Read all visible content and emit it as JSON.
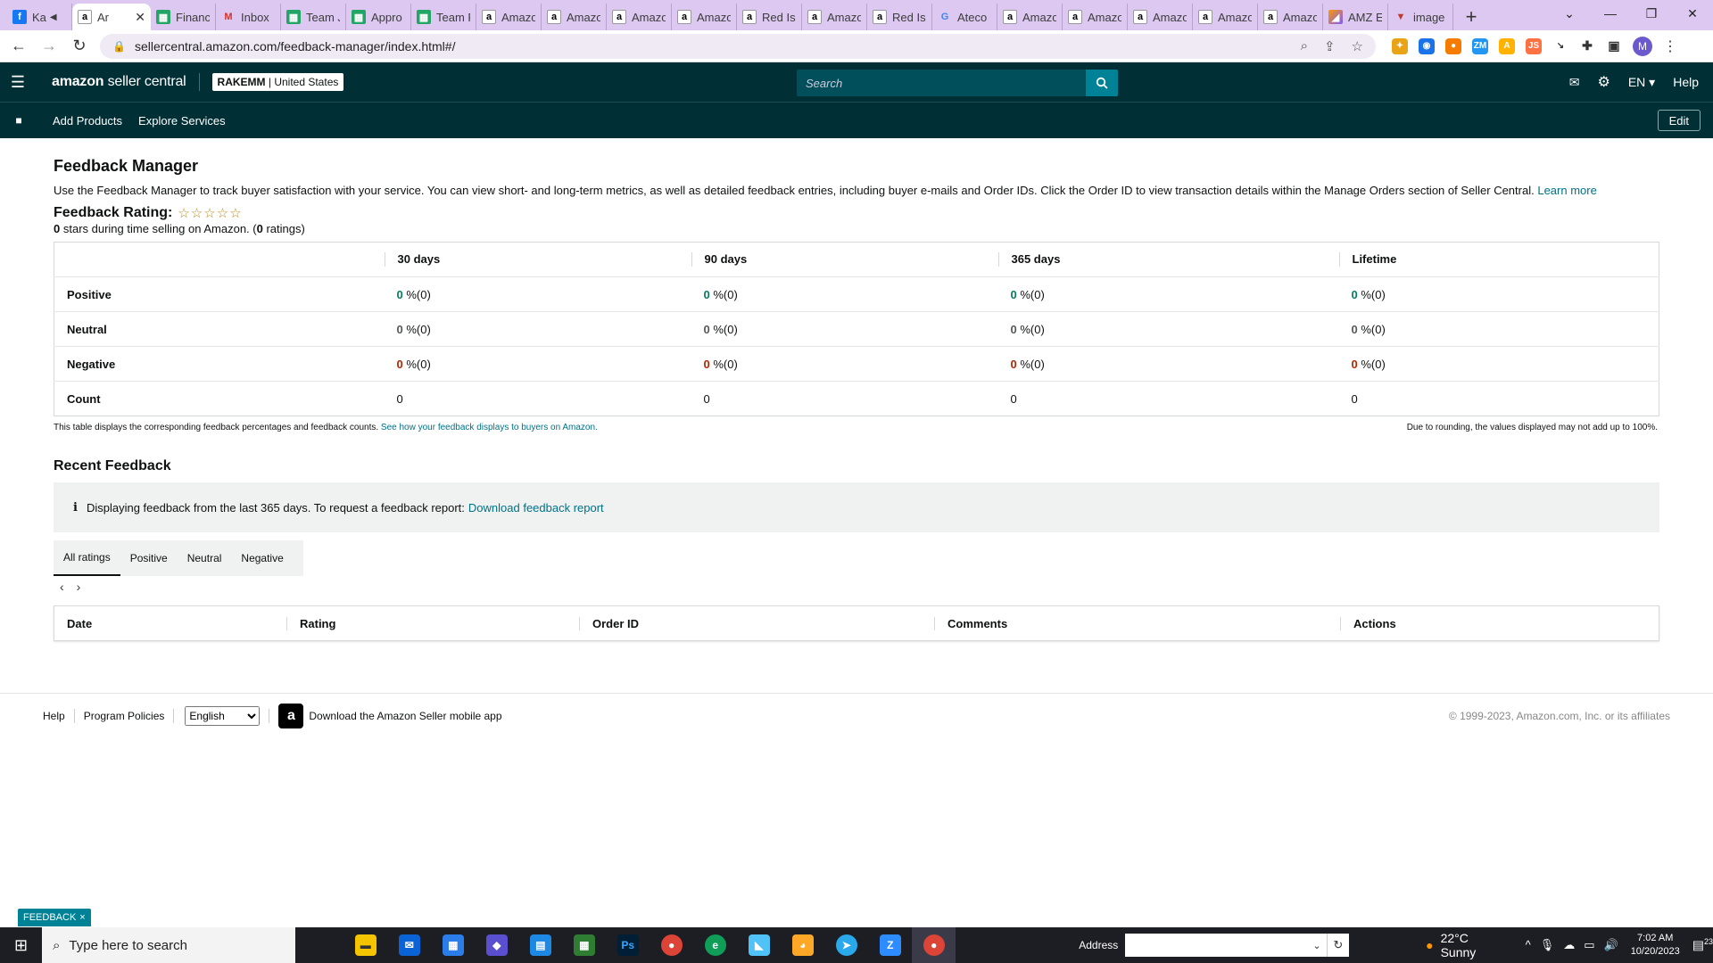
{
  "browser": {
    "tabs": [
      {
        "label": "Ka",
        "icon": "facebook-icon"
      },
      {
        "label": "Ar",
        "icon": "amazon-icon",
        "active": true
      },
      {
        "label": "Financ",
        "icon": "sheets-icon"
      },
      {
        "label": "Inbox",
        "icon": "gmail-icon"
      },
      {
        "label": "Team J",
        "icon": "sheets-icon"
      },
      {
        "label": "Appro",
        "icon": "sheets-icon"
      },
      {
        "label": "Team F",
        "icon": "sheets-icon"
      },
      {
        "label": "Amazo",
        "icon": "amazon-icon"
      },
      {
        "label": "Amazo",
        "icon": "amazon-icon"
      },
      {
        "label": "Amazo",
        "icon": "amazon-icon"
      },
      {
        "label": "Amazo",
        "icon": "amazon-icon"
      },
      {
        "label": "Red Is",
        "icon": "amazon-icon"
      },
      {
        "label": "Amazo",
        "icon": "amazon-icon"
      },
      {
        "label": "Red Is",
        "icon": "amazon-icon"
      },
      {
        "label": "Ateco",
        "icon": "google-icon"
      },
      {
        "label": "Amazo",
        "icon": "amazon-icon"
      },
      {
        "label": "Amazo",
        "icon": "amazon-icon"
      },
      {
        "label": "Amazo",
        "icon": "amazon-icon"
      },
      {
        "label": "Amazo",
        "icon": "amazon-icon"
      },
      {
        "label": "Amazo",
        "icon": "amazon-icon"
      },
      {
        "label": "AMZ E",
        "icon": "amz-tool-icon"
      },
      {
        "label": "image",
        "icon": "image-icon"
      }
    ],
    "url": "sellercentral.amazon.com/feedback-manager/index.html#/",
    "profile_initial": "M"
  },
  "header": {
    "logo_main": "amazon",
    "logo_sub": "seller central",
    "account_name": "RAKEMM",
    "account_region": "| United States",
    "search_placeholder": "Search",
    "language": "EN ▾",
    "help": "Help"
  },
  "subnav": {
    "links": [
      "Add Products",
      "Explore Services"
    ],
    "edit": "Edit"
  },
  "page": {
    "title": "Feedback Manager",
    "intro": "Use the Feedback Manager to track buyer satisfaction with your service. You can view short- and long-term metrics, as well as detailed feedback entries, including buyer e-mails and Order IDs. Click the Order ID to view transaction details within the Manage Orders section of Seller Central.",
    "learn_more": "Learn more",
    "rating_label": "Feedback Rating:",
    "stars": "☆☆☆☆☆",
    "rating_stars_value": "0",
    "rating_sub_mid": " stars during time selling on Amazon. (",
    "rating_count": "0",
    "rating_sub_end": " ratings)"
  },
  "feedback_table": {
    "columns": [
      "30 days",
      "90 days",
      "365 days",
      "Lifetime"
    ],
    "rows": [
      {
        "label": "Positive",
        "pct": [
          "0",
          "0",
          "0",
          "0"
        ],
        "suffix": " %(0)",
        "color": "#067d62"
      },
      {
        "label": "Neutral",
        "pct": [
          "0",
          "0",
          "0",
          "0"
        ],
        "suffix": " %(0)",
        "color": "#565959"
      },
      {
        "label": "Negative",
        "pct": [
          "0",
          "0",
          "0",
          "0"
        ],
        "suffix": " %(0)",
        "color": "#b12704"
      },
      {
        "label": "Count",
        "values": [
          "0",
          "0",
          "0",
          "0"
        ]
      }
    ],
    "note_left": "This table displays the corresponding feedback percentages and feedback counts.",
    "note_link": "See how your feedback displays to buyers on Amazon.",
    "note_right": "Due to rounding, the values displayed may not add up to 100%."
  },
  "recent": {
    "title": "Recent Feedback",
    "alert_text": "Displaying feedback from the last 365 days. To request a feedback report:",
    "alert_link": "Download feedback report",
    "tabs": [
      "All ratings",
      "Positive",
      "Neutral",
      "Negative"
    ],
    "columns": [
      "Date",
      "Rating",
      "Order ID",
      "Comments",
      "Actions"
    ]
  },
  "footer": {
    "help": "Help",
    "policies": "Program Policies",
    "language_select": "English",
    "app_link": "Download the Amazon Seller mobile app",
    "copyright": "© 1999-2023, Amazon.com, Inc. or its affiliates",
    "feedback_tab": "FEEDBACK"
  },
  "taskbar": {
    "search_placeholder": "Type here to search",
    "address_label": "Address",
    "weather": "22°C  Sunny",
    "time": "7:02 AM",
    "date": "10/20/2023",
    "notifications": "23"
  },
  "colors": {
    "header_bg": "#002f36",
    "search_btn": "#008296",
    "link": "#007185",
    "positive": "#067d62",
    "negative": "#b12704",
    "tabstrip_bg": "#dcc8f0"
  }
}
